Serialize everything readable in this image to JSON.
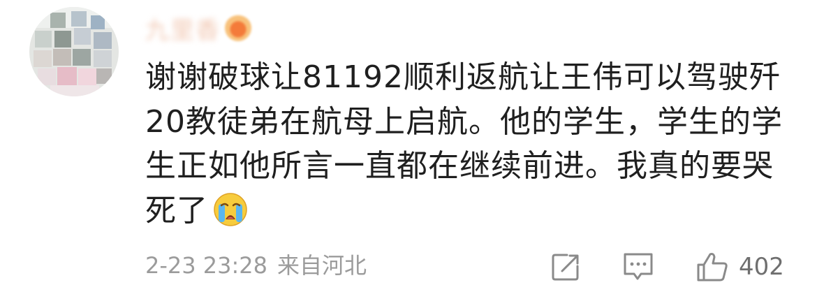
{
  "comment": {
    "author_name": "九里香",
    "text": "谢谢破球让81192顺利返航让王伟可以驾驶歼20教徒弟在航母上启航。他的学生，学生的学生正如他所言一直都在继续前进。我真的要哭死了",
    "emoji": "crying-face",
    "timestamp": "2-23 23:28",
    "location": "来自河北",
    "like_count": "402"
  },
  "icons": {
    "share": "share-edit-icon",
    "comment": "comment-icon",
    "like": "thumbs-up-icon"
  }
}
